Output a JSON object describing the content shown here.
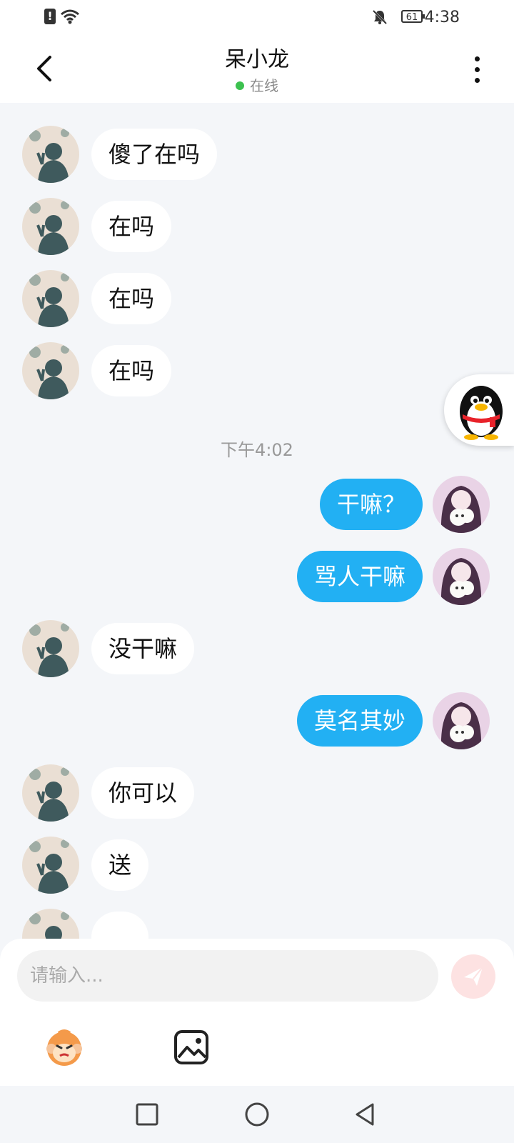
{
  "status_bar": {
    "time": "4:38",
    "battery": "61",
    "alert": "!"
  },
  "header": {
    "title": "呆小龙",
    "status": "在线"
  },
  "chat": {
    "timestamp": "下午4:02",
    "messages": [
      {
        "side": "in",
        "text": "傻了在吗"
      },
      {
        "side": "in",
        "text": "在吗"
      },
      {
        "side": "in",
        "text": "在吗"
      },
      {
        "side": "in",
        "text": "在吗"
      },
      {
        "side": "out",
        "text": "干嘛？"
      },
      {
        "side": "out",
        "text": "骂人干嘛"
      },
      {
        "side": "in",
        "text": "没干嘛"
      },
      {
        "side": "out",
        "text": "莫名其妙"
      },
      {
        "side": "in",
        "text": "你可以"
      },
      {
        "side": "in",
        "text": "送"
      }
    ]
  },
  "composer": {
    "placeholder": "请输入..."
  },
  "colors": {
    "accent": "#22b0f3",
    "online": "#3cc14f",
    "background": "#f4f6f9"
  },
  "icons": [
    "back-icon",
    "more-icon",
    "qq-penguin-icon",
    "send-icon",
    "emoji-icon",
    "image-icon",
    "nav-recents-icon",
    "nav-home-icon",
    "nav-back-icon"
  ]
}
